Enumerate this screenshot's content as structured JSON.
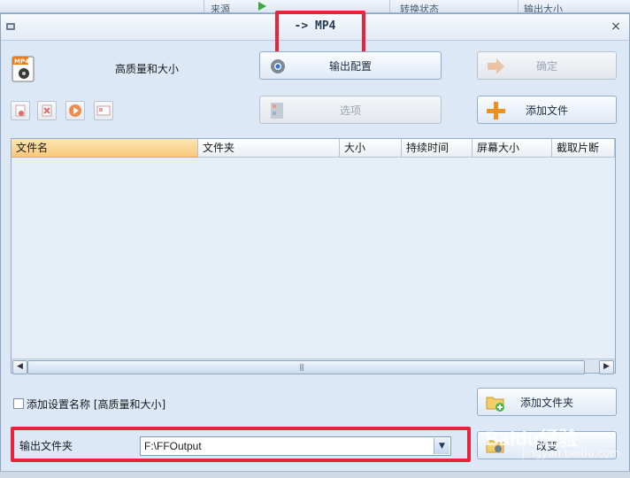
{
  "background_app": {
    "col1": "来源",
    "col2": "转换状态",
    "col3": "输出大小"
  },
  "dialog": {
    "title": "-> MP4",
    "close": "×",
    "format_icon_label": "MP4",
    "quality_label": "高质量和大小",
    "output_config_button": "输出配置",
    "ok_button": "确定",
    "options_button": "选项",
    "add_file_button": "添加文件",
    "add_folder_button": "添加文件夹",
    "change_button": "改变",
    "add_setting_name_label": "添加设置名称 [高质量和大小]",
    "output_folder_label": "输出文件夹",
    "output_folder_value": "F:\\FFOutput",
    "columns": [
      "文件名",
      "文件夹",
      "大小",
      "持续时间",
      "屏幕大小",
      "截取片断"
    ],
    "scroll_grip": "|||"
  },
  "watermark": {
    "main": "Baidu经验",
    "sub": "jingyan.baidu.com"
  },
  "colors": {
    "highlight": "#e8243a",
    "header_active": "#f8c97a",
    "accent": "#2a6fd6"
  }
}
